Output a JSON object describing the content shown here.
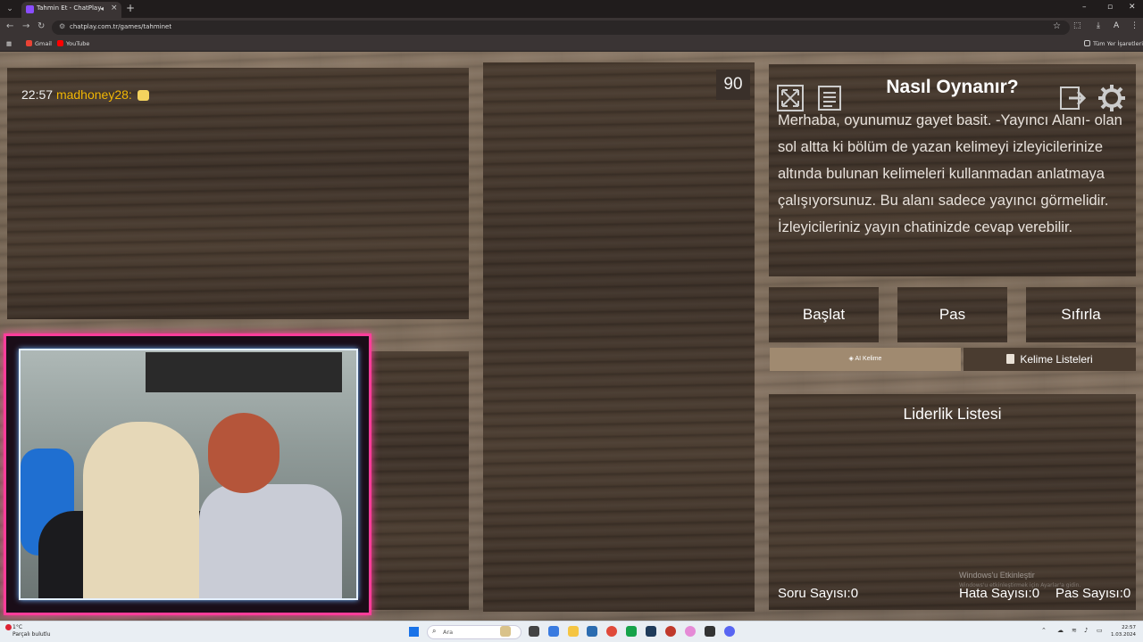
{
  "browser": {
    "tab_title": "Tahmin Et - ChatPlay",
    "url": "chatplay.com.tr/games/tahminet",
    "bookmarks": [
      "Gmail",
      "YouTube"
    ],
    "all_bookmarks": "Tüm Yer İşaretleri",
    "profile_initial": "A"
  },
  "game": {
    "timer": "90",
    "chat": {
      "time": "22:57",
      "username": "madhoney28:"
    },
    "howto": {
      "title": "Nasıl Oynanır?",
      "text": "Merhaba, oyunumuz gayet basit. -Yayıncı Alanı- olan sol altta ki bölüm de yazan kelimeyi izleyicilerinize altında bulunan kelimeleri kullanmadan anlatmaya çalışıyorsunuz. Bu alanı sadece yayıncı görmelidir. İzleyicileriniz yayın chatinizde cevap verebilir."
    },
    "buttons": {
      "start": "Başlat",
      "pass": "Pas",
      "reset": "Sıfırla",
      "ai_word": "AI Kelime",
      "word_lists": "Kelime Listeleri"
    },
    "leaderboard": {
      "title": "Liderlik Listesi"
    },
    "stats": {
      "questions": "Soru Sayısı:0",
      "errors": "Hata Sayısı:0",
      "passes": "Pas Sayısı:0"
    },
    "watermark": {
      "line1": "Windows'u Etkinleştir",
      "line2": "Windows'u etkinleştirmek için Ayarlar'a gidin."
    }
  },
  "taskbar": {
    "weather_temp": "1°C",
    "weather_desc": "Parçalı bulutlu",
    "search_placeholder": "Ara",
    "time": "22:57",
    "date": "1.03.2024"
  },
  "colors": {
    "chat_username": "#f2b705",
    "cam_border": "#ff3d9a",
    "ai_button": "#a08a70"
  },
  "icons": [
    "fullscreen-icon",
    "notes-icon",
    "exit-icon",
    "settings-gear-icon"
  ]
}
